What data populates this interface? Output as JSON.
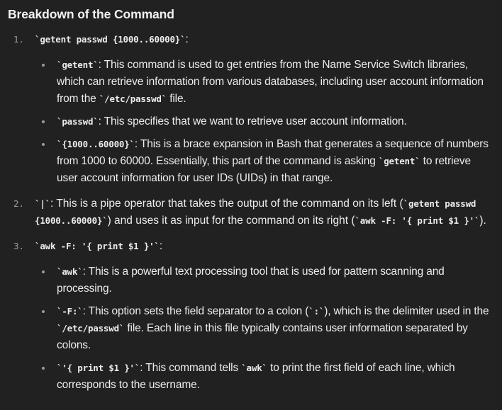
{
  "heading": "Breakdown of the Command",
  "items": [
    {
      "num": "1.",
      "code": "`getent passwd {1000..60000}`",
      "colon": ":",
      "subs": [
        {
          "code": "`getent`",
          "text1": ": This command is used to get entries from the Name Service Switch libraries, which can retrieve information from various databases, including user account information from the ",
          "code2": "`/etc/passwd`",
          "text2": " file."
        },
        {
          "code": "`passwd`",
          "text1": ": This specifies that we want to retrieve user account information."
        },
        {
          "code": "`{1000..60000}`",
          "text1": ": This is a brace expansion in Bash that generates a sequence of numbers from 1000 to 60000. Essentially, this part of the command is asking ",
          "code2": "`getent`",
          "text2": " to retrieve user account information for user IDs (UIDs) in that range."
        }
      ]
    },
    {
      "num": "2.",
      "code": "`|`",
      "text1": ": This is a pipe operator that takes the output of the command on its left (",
      "code2": "`getent passwd {1000..60000}`",
      "text2": ") and uses it as input for the command on its right (",
      "code3": "`awk -F: '{ print $1 }'`",
      "text3": ")."
    },
    {
      "num": "3.",
      "code": "`awk -F: '{ print $1 }'`",
      "colon": ":",
      "subs": [
        {
          "code": "`awk`",
          "text1": ": This is a powerful text processing tool that is used for pattern scanning and processing."
        },
        {
          "code": "`-F:`",
          "text1": ": This option sets the field separator to a colon (",
          "code2": "`:`",
          "text2": "), which is the delimiter used in the ",
          "code3": "`/etc/passwd`",
          "text3": " file. Each line in this file typically contains user information separated by colons."
        },
        {
          "code": "`'{ print $1 }'`",
          "text1": ": This command tells ",
          "code2": "`awk`",
          "text2": " to print the first field of each line, which corresponds to the username."
        }
      ]
    }
  ]
}
